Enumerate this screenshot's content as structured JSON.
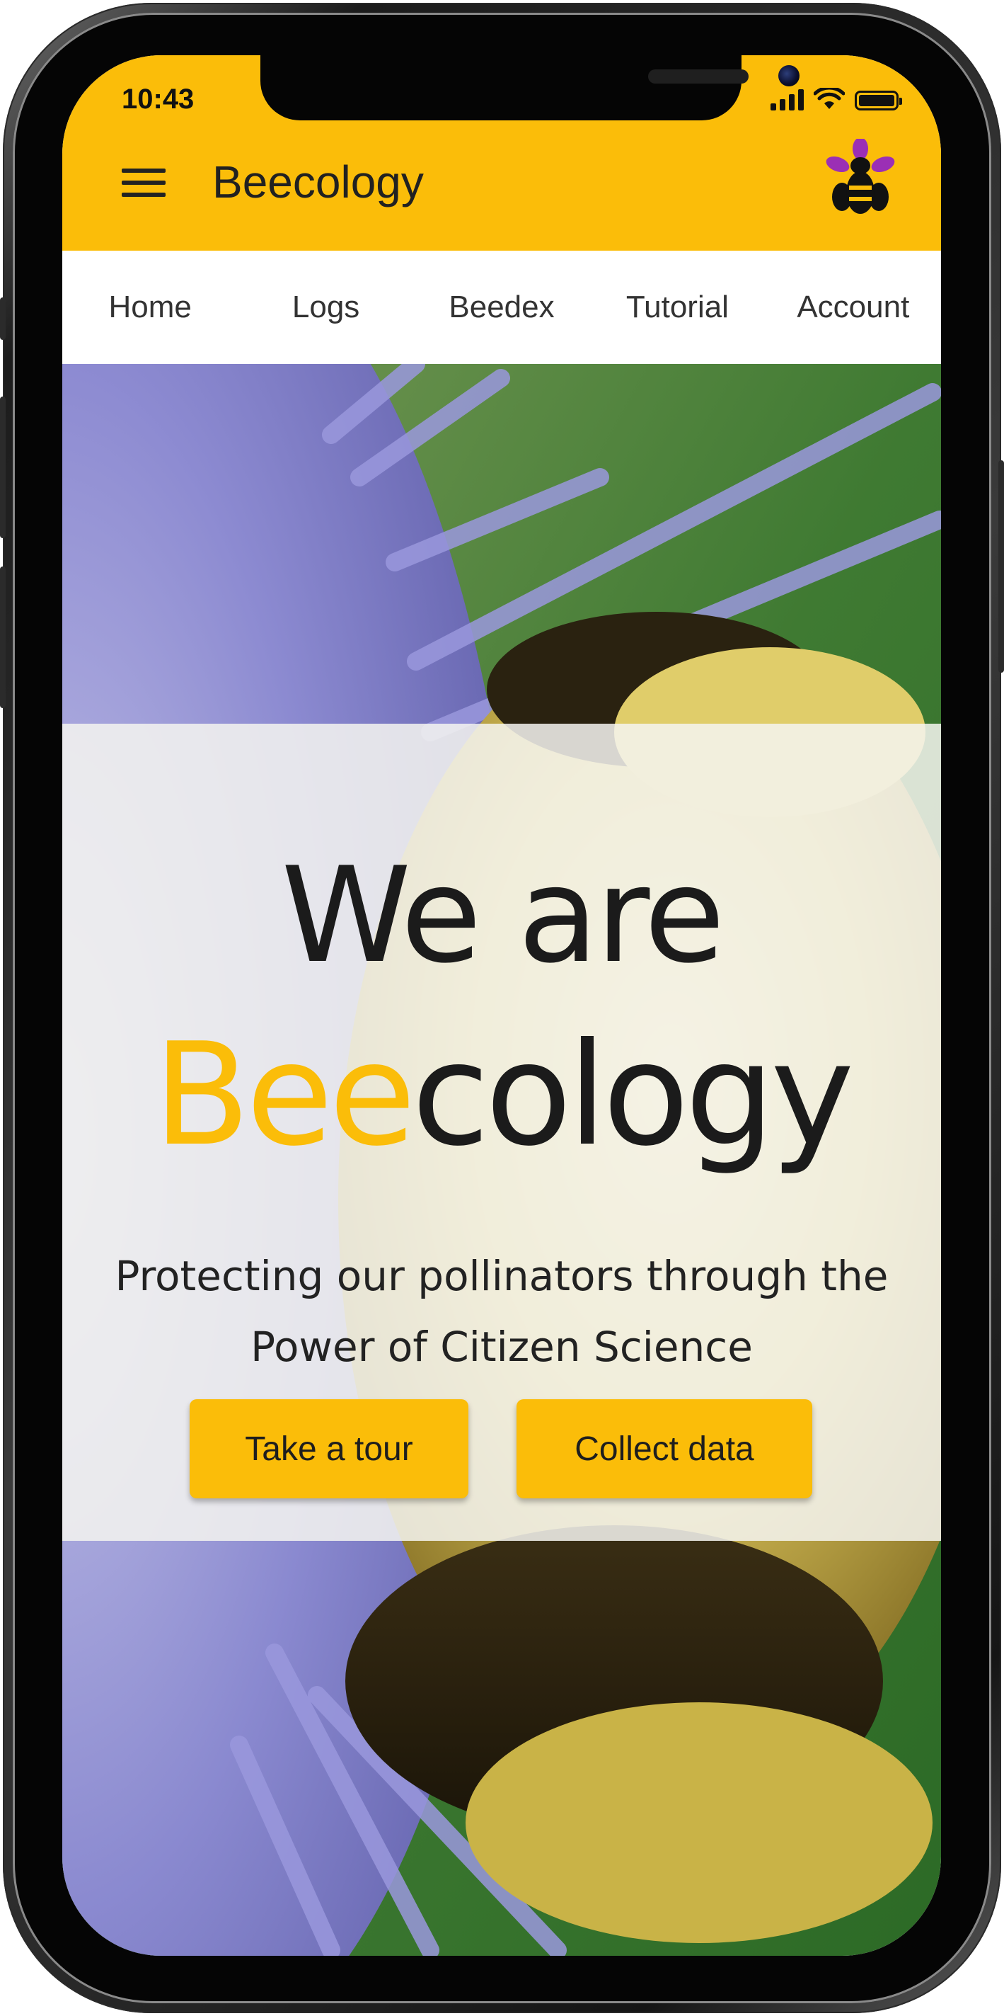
{
  "status_bar": {
    "time": "10:43",
    "icons": [
      "signal-icon",
      "wifi-icon",
      "battery-icon"
    ]
  },
  "app_bar": {
    "title": "Beecology",
    "menu_icon": "hamburger-menu-icon",
    "logo_icon": "bee-flower-logo"
  },
  "nav": {
    "tabs": [
      {
        "label": "Home"
      },
      {
        "label": "Logs"
      },
      {
        "label": "Beedex"
      },
      {
        "label": "Tutorial"
      },
      {
        "label": "Account"
      }
    ]
  },
  "hero": {
    "headline_line1": "We are",
    "headline_accent": "Bee",
    "headline_rest": "cology",
    "subtitle_line1": "Protecting our pollinators through the",
    "subtitle_line2": "Power of Citizen Science",
    "background_image": "bumblebee-on-sea-holly-flower-photo"
  },
  "buttons": {
    "tour_label": "Take a tour",
    "collect_label": "Collect data"
  },
  "colors": {
    "brand_yellow": "#fbbd09",
    "logo_purple": "#9b2fb5",
    "text_dark": "#1b1b1b"
  }
}
